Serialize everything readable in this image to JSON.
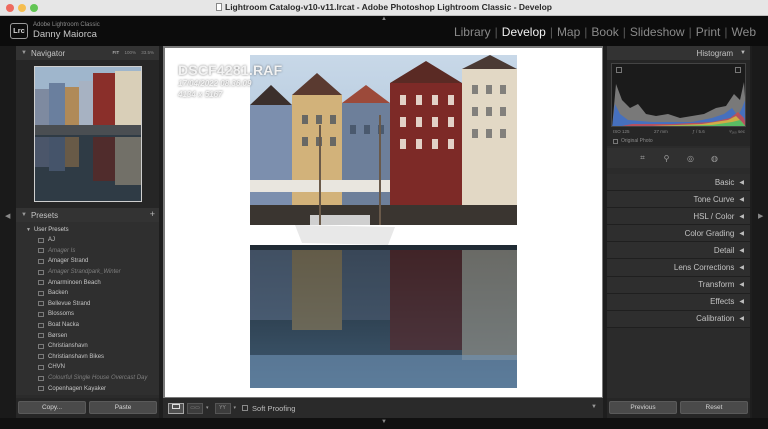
{
  "window": {
    "title": "Lightroom Catalog-v10-v11.lrcat - Adobe Photoshop Lightroom Classic - Develop"
  },
  "identity": {
    "logo": "Lrc",
    "app_name": "Adobe Lightroom Classic",
    "user_name": "Danny Maiorca"
  },
  "modules": [
    "Library",
    "Develop",
    "Map",
    "Book",
    "Slideshow",
    "Print",
    "Web"
  ],
  "active_module": "Develop",
  "navigator": {
    "title": "Navigator",
    "zoom": [
      "FIT",
      "100%",
      "33.5%"
    ]
  },
  "presets": {
    "title": "Presets",
    "group": "User Presets",
    "items": [
      {
        "name": "AJ",
        "dim": false
      },
      {
        "name": "Amager Is",
        "dim": true
      },
      {
        "name": "Amager Strand",
        "dim": false
      },
      {
        "name": "Amager Strandpark_Winter",
        "dim": true
      },
      {
        "name": "Amarminoen Beach",
        "dim": false
      },
      {
        "name": "Backen",
        "dim": false
      },
      {
        "name": "Bellevue Strand",
        "dim": false
      },
      {
        "name": "Blossoms",
        "dim": false
      },
      {
        "name": "Boat Nacka",
        "dim": false
      },
      {
        "name": "Børsen",
        "dim": false
      },
      {
        "name": "Christianshavn",
        "dim": false
      },
      {
        "name": "Christianshavn Bikes",
        "dim": false
      },
      {
        "name": "CHVN",
        "dim": false
      },
      {
        "name": "Colourful Single House Overcast Day",
        "dim": true
      },
      {
        "name": "Copenhagen Kayaker",
        "dim": false
      }
    ]
  },
  "left_buttons": {
    "copy": "Copy...",
    "paste": "Paste"
  },
  "histogram": {
    "title": "Histogram",
    "iso": "ISO 125",
    "focal": "27 mm",
    "aperture": "ƒ / 5.6",
    "shutter": "¹⁄₁₆₀ sec",
    "original_photo": "Original Photo"
  },
  "develop_sections": [
    "Basic",
    "Tone Curve",
    "HSL / Color",
    "Color Grading",
    "Detail",
    "Lens Corrections",
    "Transform",
    "Effects",
    "Calibration"
  ],
  "right_buttons": {
    "previous": "Previous",
    "reset": "Reset"
  },
  "photo_info": {
    "filename": "DSCF4281.RAF",
    "datetime": "17/04/2022 08.36.09",
    "dimensions": "4134 x 5167"
  },
  "toolbar": {
    "soft_proofing": "Soft Proofing",
    "yy": "YY"
  },
  "colors": {
    "accent": "#f0f0f0",
    "panel": "#2b2b2b",
    "background": "#1e1e1e"
  }
}
